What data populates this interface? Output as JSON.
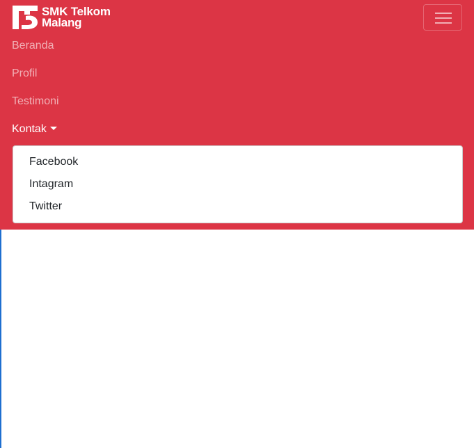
{
  "brand": {
    "name_line1": "SMK Telkom",
    "name_line2": "Malang"
  },
  "navbar": {
    "color": "#dc3545",
    "toggler_icon": "hamburger-icon",
    "items": [
      {
        "label": "Beranda"
      },
      {
        "label": "Profil"
      },
      {
        "label": "Testimoni"
      },
      {
        "label": "Kontak"
      }
    ]
  },
  "dropdown": {
    "items": [
      {
        "label": "Facebook"
      },
      {
        "label": "Intagram"
      },
      {
        "label": "Twitter"
      }
    ]
  }
}
